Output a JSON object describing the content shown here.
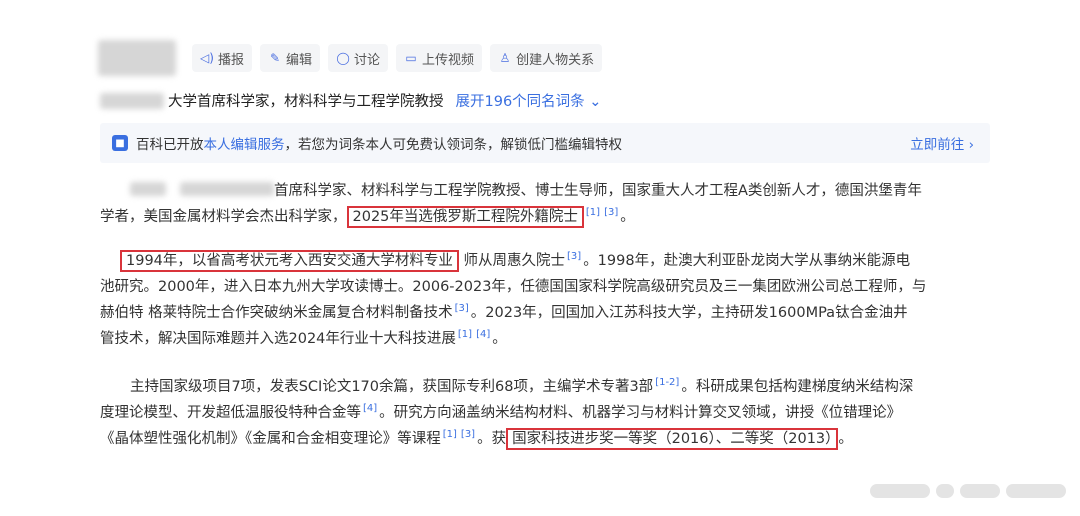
{
  "toolbar": {
    "items": [
      {
        "icon": "speaker-icon",
        "label": "播报"
      },
      {
        "icon": "pencil-icon",
        "label": "编辑"
      },
      {
        "icon": "chat-icon",
        "label": "讨论"
      },
      {
        "icon": "video-icon",
        "label": "上传视频"
      },
      {
        "icon": "people-icon",
        "label": "创建人物关系"
      }
    ]
  },
  "subtitle": {
    "text": "大学首席科学家，材料科学与工程学院教授",
    "expand_link": "展开196个同名词条 ⌄"
  },
  "notice": {
    "prefix": "百科已开放",
    "highlight": "本人编辑服务",
    "suffix": "，若您为词条本人可免费认领词条，解锁低门槛编辑特权",
    "action": "立即前往 ›"
  },
  "paragraphs": {
    "p1": {
      "l1": "首席科学家、材料科学与工程学院教授、博士生导师，国家重大人才工程A类创新人才，德国洪堡青年",
      "l2_a": "学者，美国金属材料学会杰出科学家，",
      "l2_box": "2025年当选俄罗斯工程院外籍院士",
      "l2_sup1": "[1]",
      "l2_sup2": "[3]",
      "l2_end": "。"
    },
    "p2": {
      "l1_box": "1994年，以省高考状元考入西安交通大学材料专业",
      "l1_b": "师从周惠久院士",
      "l1_sup": "[3]",
      "l1_c": "。1998年，赴澳大利亚卧龙岗大学从事纳米能源电",
      "l2": "池研究。2000年，进入日本九州大学攻读博士。2006-2023年，任德国国家科学院高级研究员及三一集团欧洲公司总工程师，与",
      "l3_a": "赫伯特 格莱特院士合作突破纳米金属复合材料制备技术",
      "l3_sup": "[3]",
      "l3_b": "。2023年，回国加入江苏科技大学，主持研发1600MPa钛合金油井",
      "l4_a": "管技术，解决国际难题并入选2024年行业十大科技进展",
      "l4_sup1": "[1]",
      "l4_sup2": "[4]",
      "l4_end": "。"
    },
    "p3": {
      "l1_a": "主持国家级项目7项，发表SCI论文170余篇，获国际专利68项，主编学术专著3部",
      "l1_sup": "[1-2]",
      "l1_b": "。科研成果包括构建梯度纳米结构深",
      "l2_a": "度理论模型、开发超低温服役特种合金等",
      "l2_sup": "[4]",
      "l2_b": "。研究方向涵盖纳米结构材料、机器学习与材料计算交叉领域，讲授《位错理论》",
      "l3_a": "《晶体塑性强化机制》《金属和合金相变理论》等课程",
      "l3_sup1": "[1]",
      "l3_sup2": "[3]",
      "l3_b": "。获",
      "l3_box": "国家科技进步奖一等奖（2016）、二等奖（2013）",
      "l3_end": "。"
    }
  },
  "colors": {
    "link": "#3a6fe0",
    "highlight_box": "#d9343b",
    "notice_bg": "#f5f7fb"
  }
}
